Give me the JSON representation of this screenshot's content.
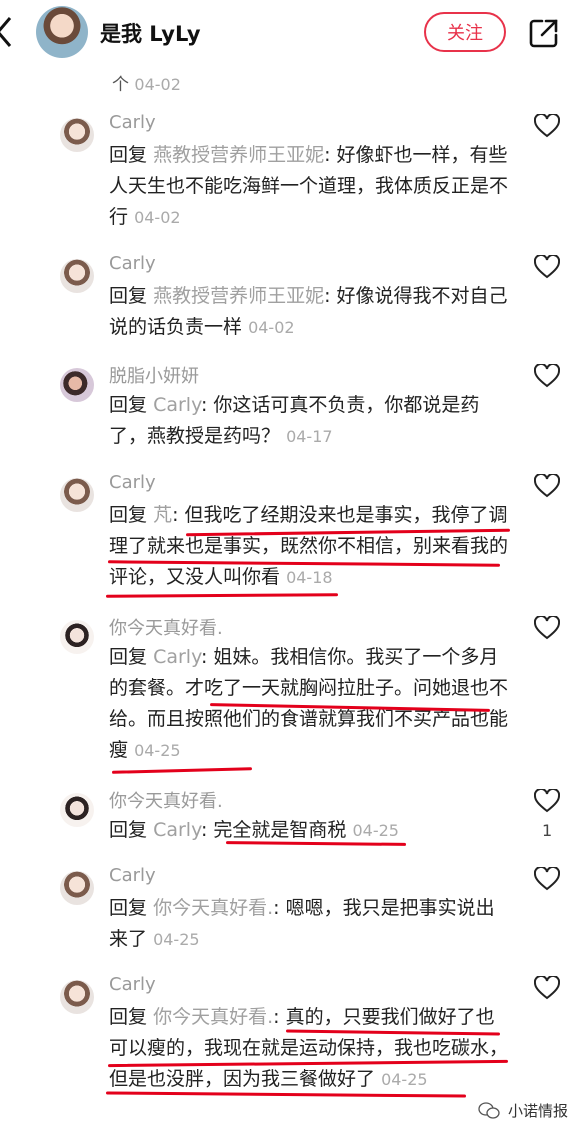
{
  "header": {
    "title": "是我 LyLy",
    "follow_label": "关注"
  },
  "top_fragment": {
    "text": "个",
    "date": "04-02"
  },
  "comments": [
    {
      "username": "Carly",
      "reply_label": "回复",
      "reply_to": "燕教授营养师王亚妮",
      "text": "好像虾也一样，有些人天生也不能吃海鲜一个道理，我体质反正是不行",
      "date": "04-02"
    },
    {
      "username": "Carly",
      "reply_label": "回复",
      "reply_to": "燕教授营养师王亚妮",
      "text": "好像说得我不对自己说的话负责一样",
      "date": "04-02"
    },
    {
      "username": "脱脂小妍妍",
      "reply_label": "回复",
      "reply_to": "Carly",
      "text": "你这话可真不负责，你都说是药了，燕教授是药吗？",
      "date": "04-17"
    },
    {
      "username": "Carly",
      "reply_label": "回复",
      "reply_to": "芃",
      "text": "但我吃了经期没来也是事实，我停了调理了就来也是事实，既然你不相信，别来看我的评论，又没人叫你看",
      "date": "04-18"
    },
    {
      "username": "你今天真好看.",
      "reply_label": "回复",
      "reply_to": "Carly",
      "text": "姐妹。我相信你。我买了一个多月的套餐。才吃了一天就胸闷拉肚子。问她退也不给。而且按照他们的食谱就算我们不买产品也能瘦",
      "date": "04-25"
    },
    {
      "username": "你今天真好看.",
      "reply_label": "回复",
      "reply_to": "Carly",
      "text": "完全就是智商税",
      "date": "04-25",
      "likes": "1"
    },
    {
      "username": "Carly",
      "reply_label": "回复",
      "reply_to": "你今天真好看.",
      "text": "嗯嗯，我只是把事实说出来了",
      "date": "04-25"
    },
    {
      "username": "Carly",
      "reply_label": "回复",
      "reply_to": "你今天真好看.",
      "text": "真的，只要我们做好了也可以瘦的，我现在就是运动保持，我也吃碳水，但是也没胖，因为我三餐做好了",
      "date": "04-25"
    }
  ],
  "watermark": {
    "text": "小诺情报"
  }
}
